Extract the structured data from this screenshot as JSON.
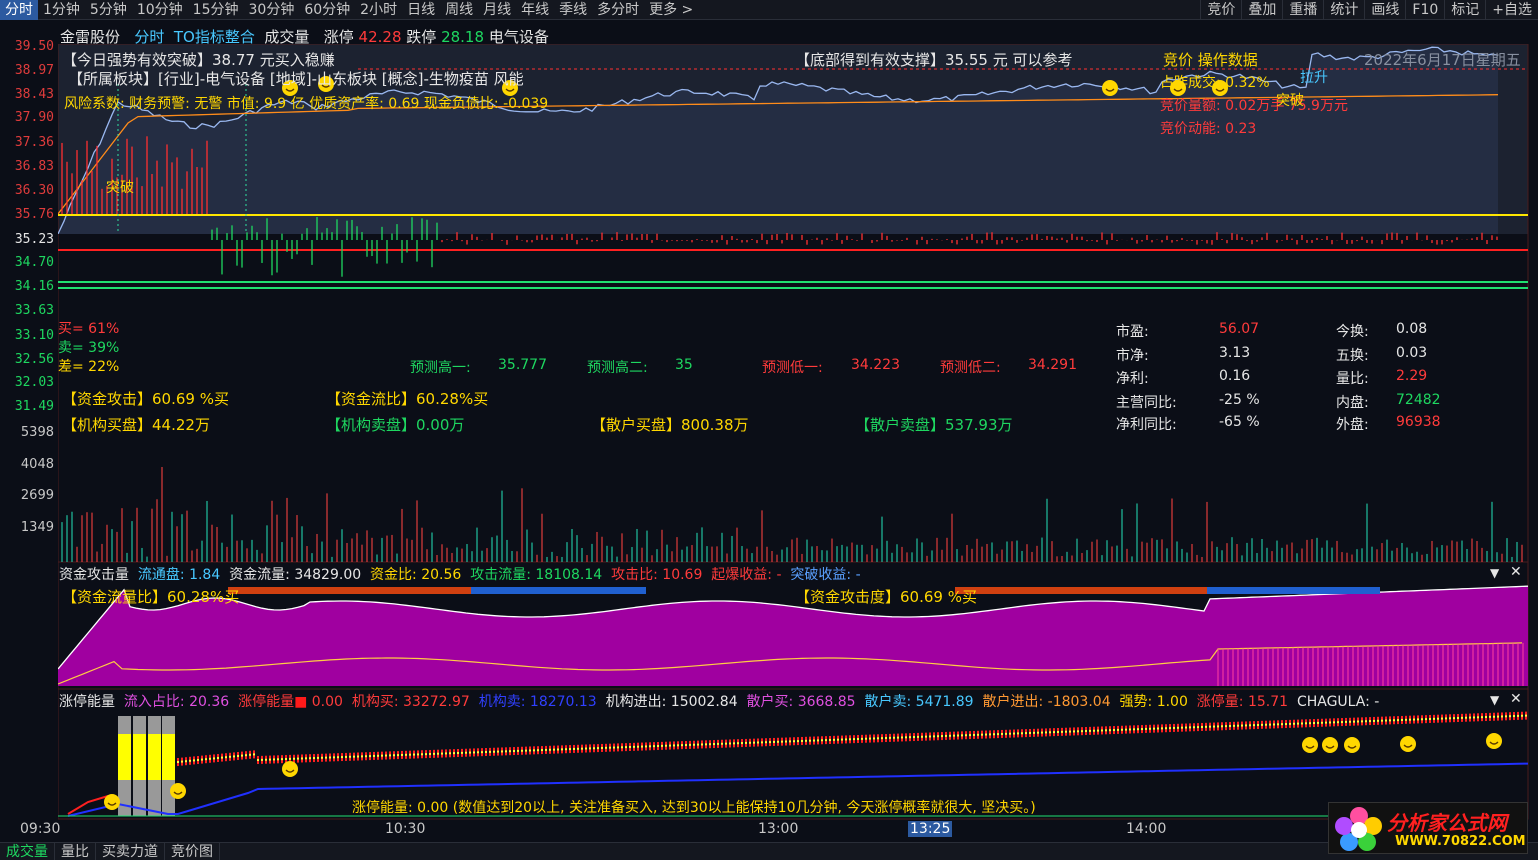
{
  "toolbar": {
    "timeframes": [
      "分时",
      "1分钟",
      "5分钟",
      "10分钟",
      "15分钟",
      "30分钟",
      "60分钟",
      "2小时",
      "日线",
      "周线",
      "月线",
      "年线",
      "季线",
      "多分时",
      "更多 >"
    ],
    "right": [
      "竞价",
      "叠加",
      "重播",
      "统计",
      "画线",
      "F10",
      "标记",
      "+自选"
    ]
  },
  "header": {
    "stock": "金雷股份",
    "mode": "分时",
    "indicator": "TO指标整合",
    "vol": "成交量",
    "limit_up_label": "涨停",
    "limit_up": "42.28",
    "limit_down_label": "跌停",
    "limit_down": "28.18",
    "industry": "电气设备"
  },
  "price_scale": [
    "39.50",
    "38.97",
    "38.43",
    "37.90",
    "37.36",
    "36.83",
    "36.30",
    "35.76",
    "35.23",
    "34.70",
    "34.16",
    "33.63",
    "33.10",
    "32.56",
    "32.03",
    "31.49"
  ],
  "vol_scale": [
    "5398",
    "4048",
    "2699",
    "1349"
  ],
  "time_axis": [
    "09:30",
    "10:30",
    "13:00",
    "13:25",
    "14:00"
  ],
  "notes": {
    "breakout": "【今日强势有效突破】38.77 元买入稳赚",
    "support": "【底部得到有效支撑】35.55 元 可以参考",
    "sector": "【所属板块】[行业]-电气设备 [地域]-山东板块 [概念]-生物疫苗 风能",
    "risk": "风险系数: 财务预警: 无警 市值: 9.9 亿 优质资产率: 0.69 现金负债比: -0.039",
    "auction_title": "竞价 操作数据",
    "auction_ratio": "占昨成交: 0.32%",
    "auction_amount": "竞价量额: 0.02万手  75.9万元",
    "auction_momentum": "竞价动能: 0.23",
    "date": "2022年6月17日星期五",
    "tag_breakout": "突破",
    "tag_lift": "拉升",
    "tag_breakout2": "突破"
  },
  "ratios": {
    "buy": "买= 61%",
    "sell": "卖= 39%",
    "diff": "差= 22%"
  },
  "predict": {
    "h1_label": "预测高一:",
    "h1": "35.777",
    "h2_label": "预测高二:",
    "h2": "35",
    "l1_label": "预测低一:",
    "l1": "34.223",
    "l2_label": "预测低二:",
    "l2": "34.291"
  },
  "funds": {
    "attack": "【资金攻击】60.69 %买",
    "flow": "【资金流比】60.28%买",
    "inst_buy": "【机构买盘】44.22万",
    "inst_sell": "【机构卖盘】0.00万",
    "retail_buy": "【散户买盘】800.38万",
    "retail_sell": "【散户卖盘】537.93万"
  },
  "fundamentals": {
    "pe_l": "市盈:",
    "pe": "56.07",
    "pb_l": "市净:",
    "pb": "3.13",
    "np_l": "净利:",
    "np": "0.16",
    "rev_l": "主营同比:",
    "rev": "-25 %",
    "npg_l": "净利同比:",
    "npg": "-65 %",
    "to_l": "今换:",
    "to": "0.08",
    "to5_l": "五换:",
    "to5": "0.03",
    "vr_l": "量比:",
    "vr": "2.29",
    "in_l": "内盘:",
    "in": "72482",
    "out_l": "外盘:",
    "out": "96938"
  },
  "panel2": {
    "title": "资金攻击量",
    "float_l": "流通盘:",
    "float": "1.84",
    "flow_l": "资金流量:",
    "flow": "34829.00",
    "ratio_l": "资金比:",
    "ratio": "20.56",
    "atk_l": "攻击流量:",
    "atk": "18108.14",
    "atkr_l": "攻击比:",
    "atkr": "10.69",
    "boom_l": "起爆收益:",
    "boom": "-",
    "brk_l": "突破收益:",
    "brk": "-",
    "flowratio": "【资金流量比】60.28%买",
    "attackdeg": "【资金攻击度】60.69 %买"
  },
  "panel3": {
    "title": "涨停能量",
    "inflow_l": "流入占比:",
    "inflow": "20.36",
    "energy_l": "涨停能量",
    "energy": "0.00",
    "ibuy_l": "机构买:",
    "ibuy": "33272.97",
    "isell_l": "机构卖:",
    "isell": "18270.13",
    "inet_l": "机构进出:",
    "inet": "15002.84",
    "rbuy_l": "散户买:",
    "rbuy": "3668.85",
    "rsell_l": "散户卖:",
    "rsell": "5471.89",
    "rnet_l": "散户进出:",
    "rnet": "-1803.04",
    "str_l": "强势:",
    "str": "1.00",
    "lim_l": "涨停量:",
    "lim": "15.71",
    "cha_l": "CHAGULA:",
    "cha": "-",
    "note": "涨停能量: 0.00 (数值达到20以上, 关注准备买入, 达到30以上能保持10几分钟, 今天涨停概率就很大, 坚决买。)"
  },
  "footer": [
    "成交量",
    "量比",
    "买卖力道",
    "竞价图"
  ],
  "logo": {
    "name": "分析家公式网",
    "url": "WWW.70822.COM"
  }
}
